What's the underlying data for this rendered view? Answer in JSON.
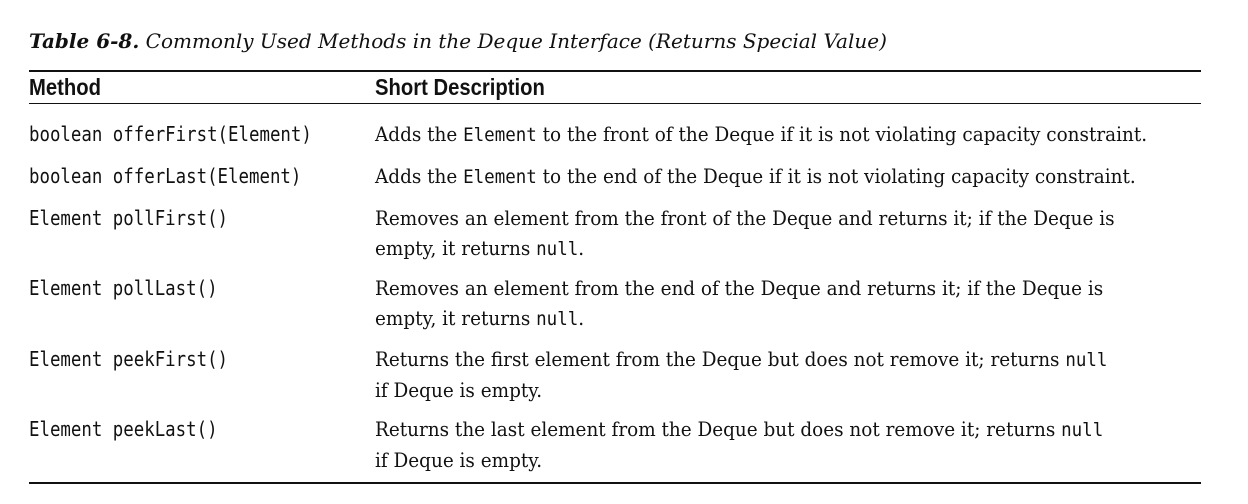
{
  "caption": {
    "label": "Table 6-8.",
    "text": "Commonly Used Methods in the Deque Interface (Returns Special Value)"
  },
  "headers": {
    "method": "Method",
    "description": "Short Description"
  },
  "rows": [
    {
      "method": "boolean offerFirst(Element)",
      "lines": [
        [
          {
            "t": "Adds the ",
            "mono": false
          },
          {
            "t": "Element",
            "mono": true
          },
          {
            "t": " to the front of the Deque if it is not violating capacity constraint.",
            "mono": false
          }
        ]
      ]
    },
    {
      "method": "boolean offerLast(Element)",
      "lines": [
        [
          {
            "t": "Adds the ",
            "mono": false
          },
          {
            "t": "Element",
            "mono": true
          },
          {
            "t": " to the end of the Deque if it is not violating capacity constraint.",
            "mono": false
          }
        ]
      ]
    },
    {
      "method": "Element pollFirst()",
      "lines": [
        [
          {
            "t": "Removes an element from the front of the Deque and returns it; if the Deque is",
            "mono": false
          }
        ],
        [
          {
            "t": "empty, it returns ",
            "mono": false
          },
          {
            "t": "null",
            "mono": true
          },
          {
            "t": ".",
            "mono": false
          }
        ]
      ]
    },
    {
      "method": "Element pollLast()",
      "lines": [
        [
          {
            "t": "Removes an element from the end of the Deque and returns it; if the Deque is",
            "mono": false
          }
        ],
        [
          {
            "t": "empty, it returns ",
            "mono": false
          },
          {
            "t": "null",
            "mono": true
          },
          {
            "t": ".",
            "mono": false
          }
        ]
      ]
    },
    {
      "method": "Element peekFirst()",
      "lines": [
        [
          {
            "t": "Returns the first element from the Deque but does not remove it; returns ",
            "mono": false
          },
          {
            "t": "null",
            "mono": true
          }
        ],
        [
          {
            "t": "if Deque is empty.",
            "mono": false
          }
        ]
      ]
    },
    {
      "method": "Element peekLast()",
      "lines": [
        [
          {
            "t": "Returns the last element from the Deque but does not remove it; returns ",
            "mono": false
          },
          {
            "t": "null",
            "mono": true
          }
        ],
        [
          {
            "t": "if Deque is empty.",
            "mono": false
          }
        ]
      ]
    }
  ]
}
